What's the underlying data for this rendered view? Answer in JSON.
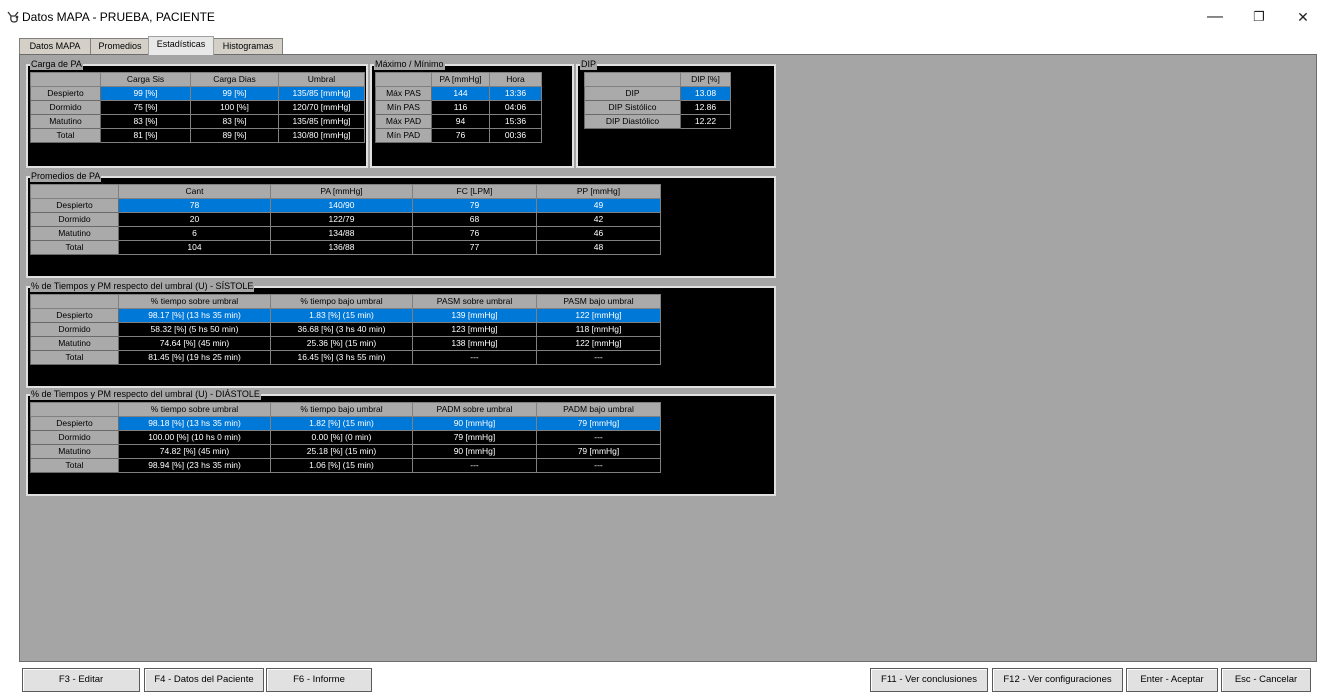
{
  "window": {
    "title": "Datos MAPA - PRUEBA, PACIENTE",
    "minimize": "—",
    "restore": "❐",
    "close": "✕"
  },
  "tabs": [
    "Datos MAPA",
    "Promedios",
    "Estadísticas",
    "Histogramas"
  ],
  "active_tab": "Estadísticas",
  "carga": {
    "title": "Carga de PA",
    "headers": [
      "Carga Sis",
      "Carga Dias",
      "Umbral"
    ],
    "rows": [
      {
        "label": "Despierto",
        "cells": [
          "99 [%]",
          "99 [%]",
          "135/85 [mmHg]"
        ]
      },
      {
        "label": "Dormido",
        "cells": [
          "75 [%]",
          "100 [%]",
          "120/70 [mmHg]"
        ]
      },
      {
        "label": "Matutino",
        "cells": [
          "83 [%]",
          "83 [%]",
          "135/85 [mmHg]"
        ]
      },
      {
        "label": "Total",
        "cells": [
          "81 [%]",
          "89 [%]",
          "130/80 [mmHg]"
        ]
      }
    ]
  },
  "maxmin": {
    "title": "Máximo / Mínimo",
    "headers": [
      "PA [mmHg]",
      "Hora"
    ],
    "rows": [
      {
        "label": "Máx PAS",
        "cells": [
          "144",
          "13:36"
        ]
      },
      {
        "label": "Mín PAS",
        "cells": [
          "116",
          "04:06"
        ]
      },
      {
        "label": "Máx PAD",
        "cells": [
          "94",
          "15:36"
        ]
      },
      {
        "label": "Mín PAD",
        "cells": [
          "76",
          "00:36"
        ]
      }
    ]
  },
  "dip": {
    "title": "DIP",
    "headers": [
      "DIP [%]"
    ],
    "rows": [
      {
        "label": "DIP",
        "cells": [
          "13.08"
        ]
      },
      {
        "label": "DIP Sistólico",
        "cells": [
          "12.86"
        ]
      },
      {
        "label": "DIP Diastólico",
        "cells": [
          "12.22"
        ]
      }
    ]
  },
  "promedios": {
    "title": "Promedios de PA",
    "headers": [
      "Cant",
      "PA [mmHg]",
      "FC [LPM]",
      "PP [mmHg]"
    ],
    "rows": [
      {
        "label": "Despierto",
        "cells": [
          "78",
          "140/90",
          "79",
          "49"
        ]
      },
      {
        "label": "Dormido",
        "cells": [
          "20",
          "122/79",
          "68",
          "42"
        ]
      },
      {
        "label": "Matutino",
        "cells": [
          "6",
          "134/88",
          "76",
          "46"
        ]
      },
      {
        "label": "Total",
        "cells": [
          "104",
          "136/88",
          "77",
          "48"
        ]
      }
    ]
  },
  "sistole": {
    "title": "% de Tiempos y PM respecto del umbral (U) - SÍSTOLE",
    "headers": [
      "% tiempo sobre umbral",
      "% tiempo bajo umbral",
      "PASM sobre umbral",
      "PASM bajo umbral"
    ],
    "rows": [
      {
        "label": "Despierto",
        "cells": [
          "98.17 [%] (13 hs 35 min)",
          "1.83 [%] (15 min)",
          "139 [mmHg]",
          "122 [mmHg]"
        ]
      },
      {
        "label": "Dormido",
        "cells": [
          "58.32 [%] (5 hs 50 min)",
          "36.68 [%] (3 hs 40 min)",
          "123 [mmHg]",
          "118 [mmHg]"
        ]
      },
      {
        "label": "Matutino",
        "cells": [
          "74.64 [%] (45 min)",
          "25.36 [%] (15 min)",
          "138 [mmHg]",
          "122 [mmHg]"
        ]
      },
      {
        "label": "Total",
        "cells": [
          "81.45 [%] (19 hs 25 min)",
          "16.45 [%] (3 hs 55 min)",
          "---",
          "---"
        ]
      }
    ]
  },
  "diastole": {
    "title": "% de Tiempos y PM respecto del umbral (U) - DIÁSTOLE",
    "headers": [
      "% tiempo sobre umbral",
      "% tiempo bajo umbral",
      "PADM sobre umbral",
      "PADM bajo umbral"
    ],
    "rows": [
      {
        "label": "Despierto",
        "cells": [
          "98.18 [%] (13 hs 35 min)",
          "1.82 [%] (15 min)",
          "90 [mmHg]",
          "79 [mmHg]"
        ]
      },
      {
        "label": "Dormido",
        "cells": [
          "100.00 [%] (10 hs 0 min)",
          "0.00 [%] (0 min)",
          "79 [mmHg]",
          "---"
        ]
      },
      {
        "label": "Matutino",
        "cells": [
          "74.82 [%] (45 min)",
          "25.18 [%] (15 min)",
          "90 [mmHg]",
          "79 [mmHg]"
        ]
      },
      {
        "label": "Total",
        "cells": [
          "98.94 [%] (23 hs 35 min)",
          "1.06 [%] (15 min)",
          "---",
          "---"
        ]
      }
    ]
  },
  "buttons": {
    "editar": "F3 - Editar",
    "datos_paciente": "F4 - Datos del Paciente",
    "informe": "F6 - Informe",
    "conclusiones": "F11 - Ver conclusiones",
    "configuraciones": "F12 - Ver configuraciones",
    "aceptar": "Enter - Aceptar",
    "cancelar": "Esc - Cancelar"
  },
  "colors": {
    "selection": "#0078d7",
    "panel_bg": "#a5a5a5",
    "grid_bg": "#000000"
  }
}
